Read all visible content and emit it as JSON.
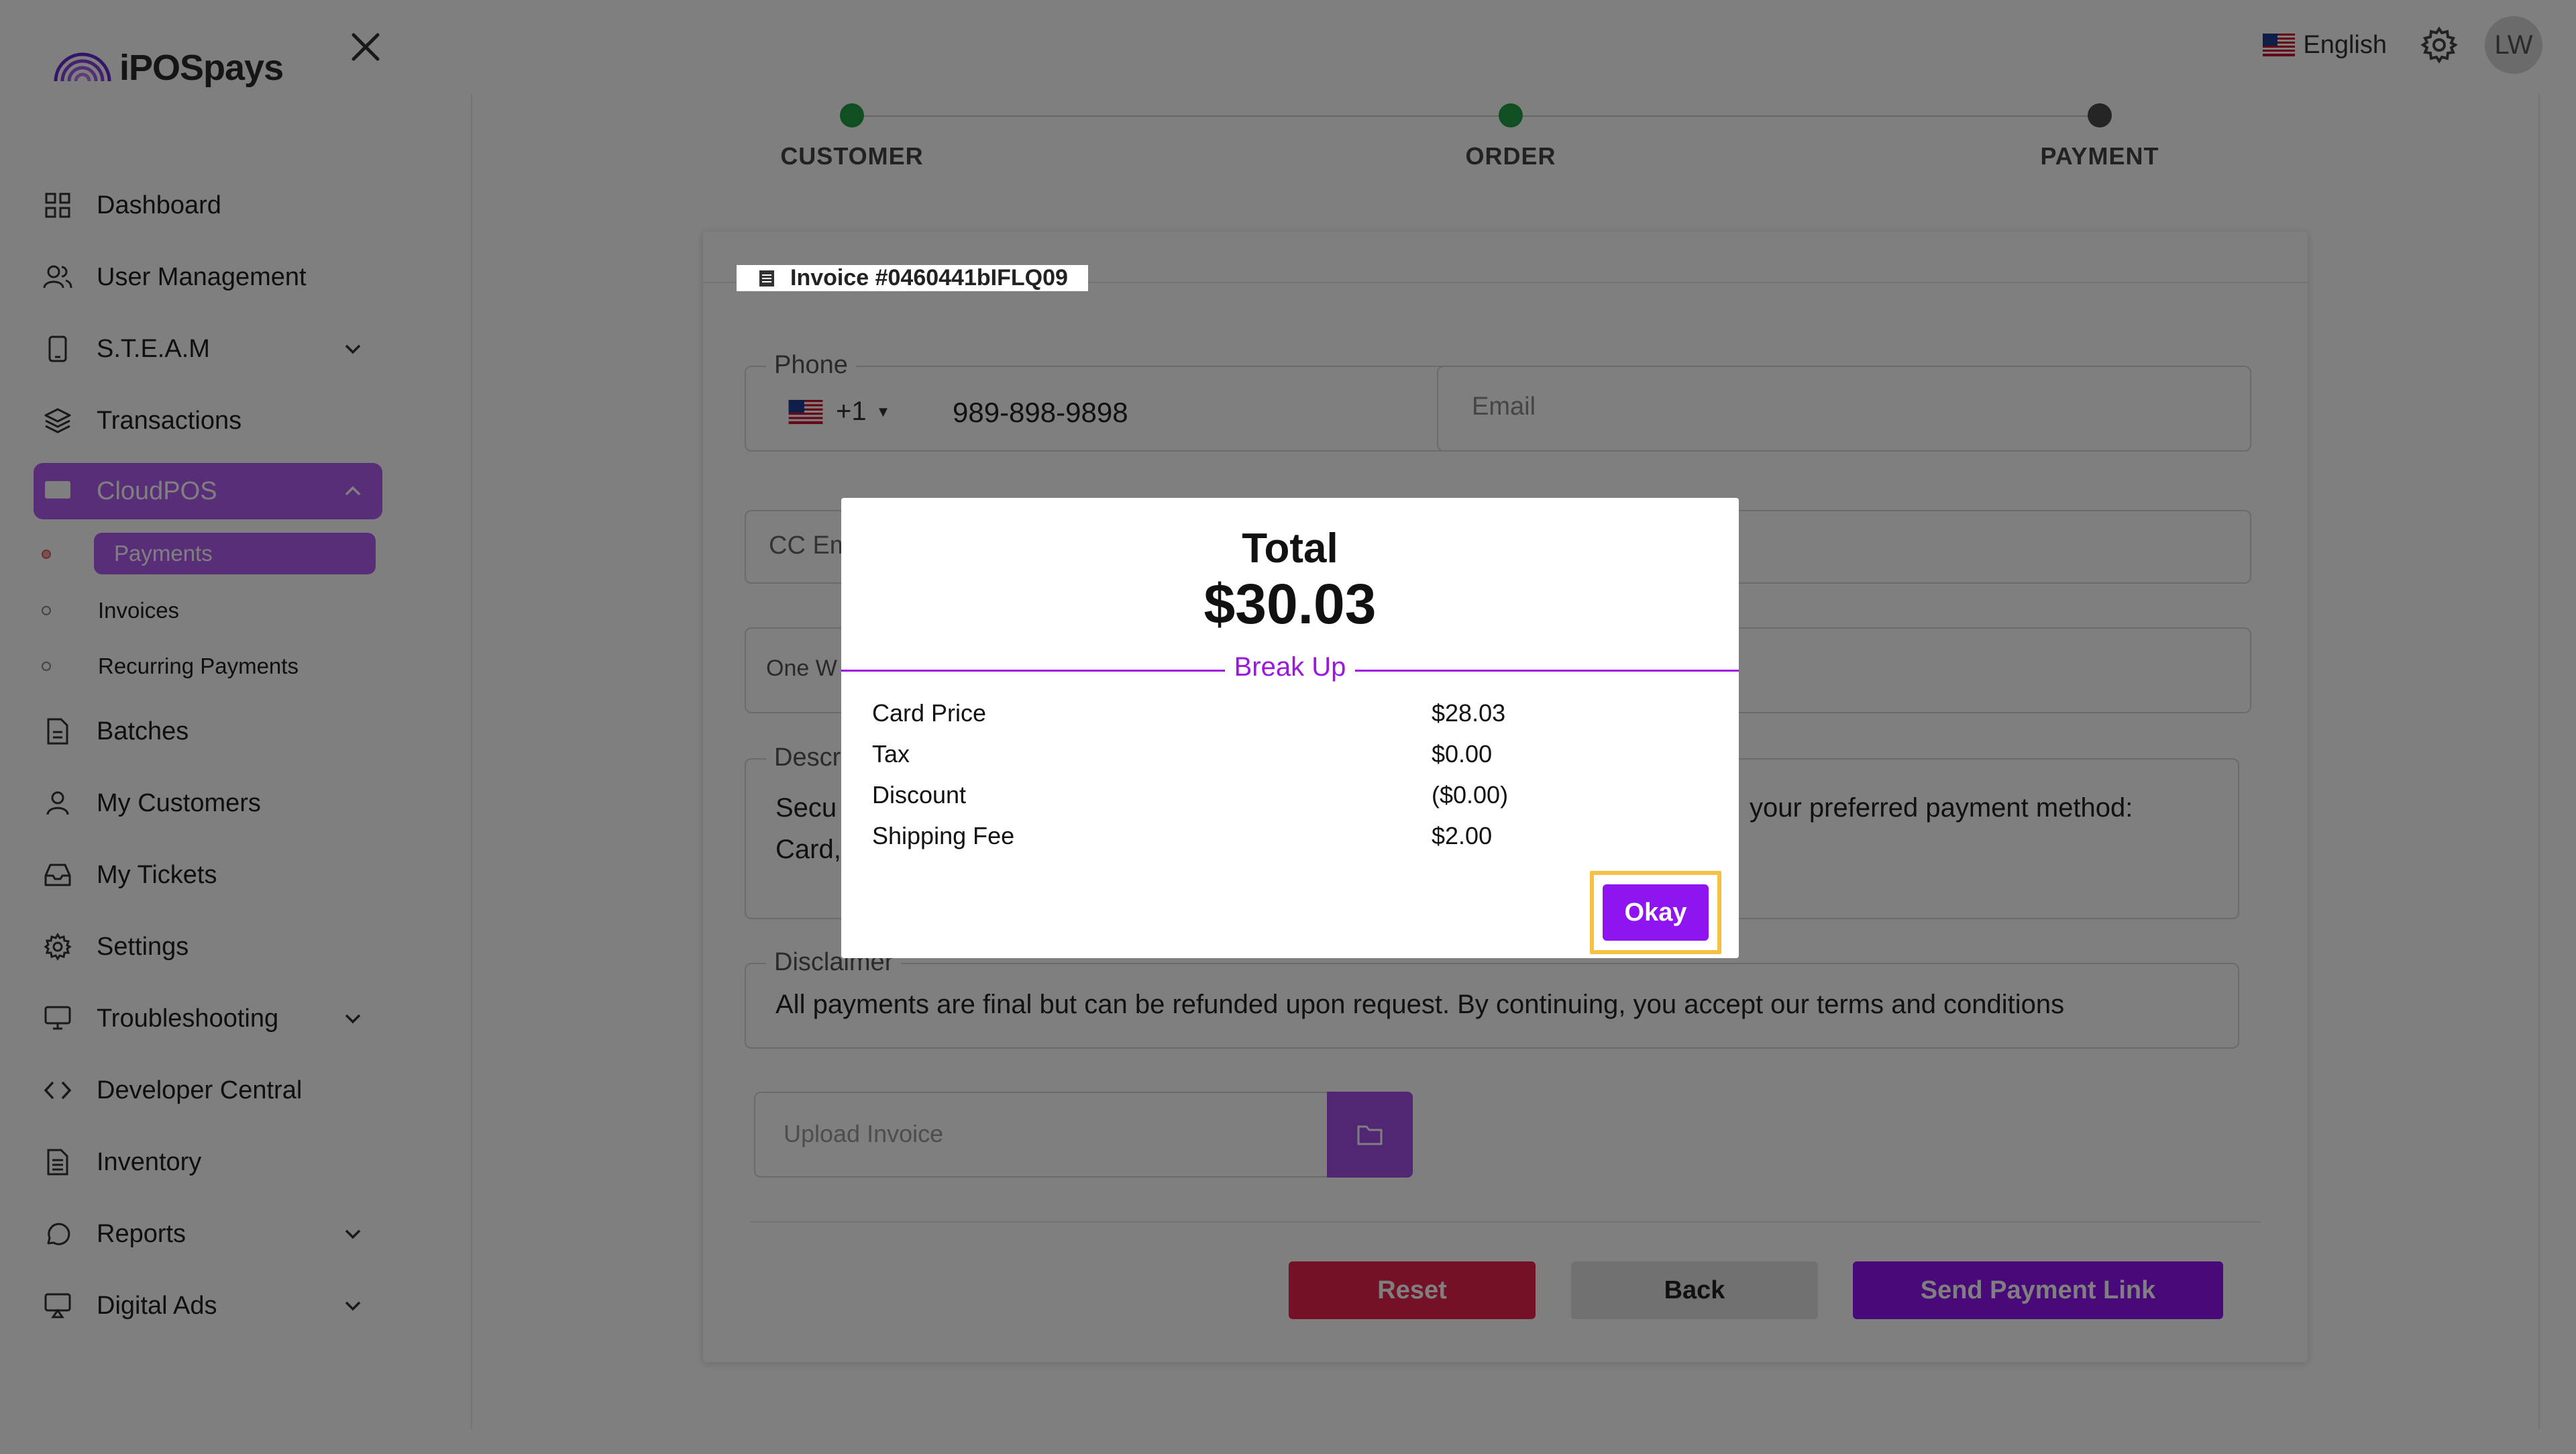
{
  "brand": {
    "name": "iPOSpays"
  },
  "sidebar": {
    "items": [
      {
        "label": "Dashboard"
      },
      {
        "label": "User Management"
      },
      {
        "label": "S.T.E.A.M"
      },
      {
        "label": "Transactions"
      },
      {
        "label": "CloudPOS"
      },
      {
        "label": "Batches"
      },
      {
        "label": "My Customers"
      },
      {
        "label": "My Tickets"
      },
      {
        "label": "Settings"
      },
      {
        "label": "Troubleshooting"
      },
      {
        "label": "Developer Central"
      },
      {
        "label": "Inventory"
      },
      {
        "label": "Reports"
      },
      {
        "label": "Digital Ads"
      }
    ],
    "sub_items": [
      {
        "label": "Payments"
      },
      {
        "label": "Invoices"
      },
      {
        "label": "Recurring Payments"
      }
    ]
  },
  "topbar": {
    "language": "English",
    "avatar_initials": "LW"
  },
  "stepper": {
    "steps": [
      {
        "label": "CUSTOMER",
        "state": "done",
        "color": "#1e9e44"
      },
      {
        "label": "ORDER",
        "state": "done",
        "color": "#1e9e44"
      },
      {
        "label": "PAYMENT",
        "state": "current",
        "color": "#4a4a4a"
      }
    ]
  },
  "form": {
    "invoice_title": "Invoice #0460441bIFLQ09",
    "phone_label": "Phone",
    "phone_country_code": "+1",
    "phone_value": "989-898-9898",
    "email_placeholder": "Email",
    "cc_email_placeholder": "CC Em",
    "one_way_placeholder": "One W",
    "description_label": "Descr",
    "description_text_left_1": "Secu",
    "description_text_left_2": "Card,",
    "description_text_right": "your preferred payment method:",
    "disclaimer_label": "Disclaimer",
    "disclaimer_text": "All payments are final but can be refunded upon request. By continuing, you accept our terms and conditions",
    "upload_placeholder": "Upload Invoice",
    "reset_label": "Reset",
    "back_label": "Back",
    "send_label": "Send Payment Link"
  },
  "modal": {
    "title": "Total",
    "amount": "$30.03",
    "breakup_label": "Break Up",
    "rows": [
      {
        "label": "Card Price",
        "value": "$28.03"
      },
      {
        "label": "Tax",
        "value": "$0.00"
      },
      {
        "label": "Discount",
        "value": "($0.00)"
      },
      {
        "label": "Shipping Fee",
        "value": "$2.00"
      }
    ],
    "okay_label": "Okay"
  },
  "colors": {
    "accent_purple": "#8e14f0",
    "sidebar_active": "#b25cf0",
    "reset_red": "#e8224f",
    "highlight_yellow": "#f6c143"
  }
}
